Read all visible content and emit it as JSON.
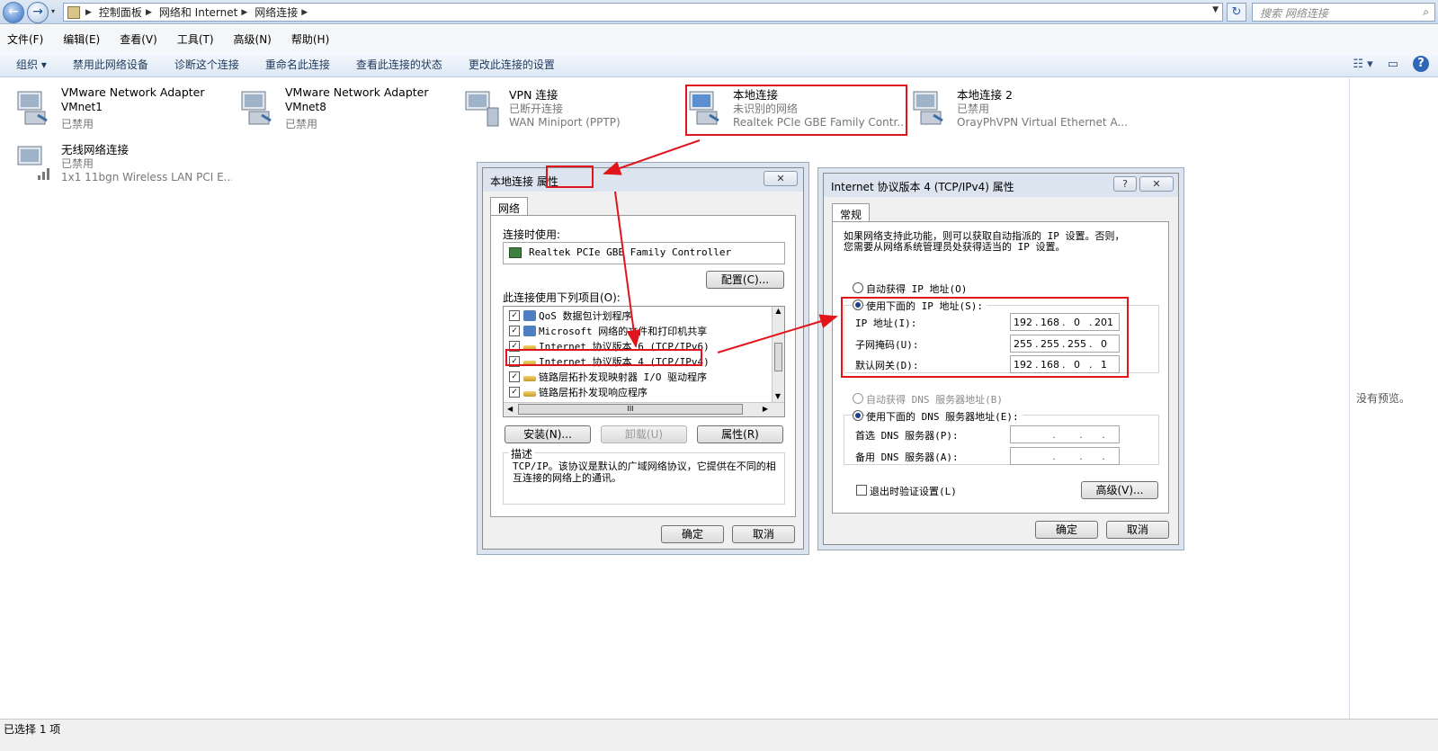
{
  "address": {
    "breadcrumb": [
      "控制面板",
      "网络和 Internet",
      "网络连接"
    ],
    "search_placeholder": "搜索 网络连接"
  },
  "menu": [
    "文件(F)",
    "编辑(E)",
    "查看(V)",
    "工具(T)",
    "高级(N)",
    "帮助(H)"
  ],
  "toolbar": {
    "organize": "组织 ▾",
    "items": [
      "禁用此网络设备",
      "诊断这个连接",
      "重命名此连接",
      "查看此连接的状态",
      "更改此连接的设置"
    ]
  },
  "adapters": [
    {
      "name": "VMware Network Adapter VMnet1",
      "line1": "VMware Network Adapter",
      "line2": "VMnet1",
      "line3": "已禁用"
    },
    {
      "name": "VMware Network Adapter VMnet8",
      "line1": "VMware Network Adapter",
      "line2": "VMnet8",
      "line3": "已禁用"
    },
    {
      "name": "VPN 连接",
      "line1": "VPN 连接",
      "line2": "已断开连接",
      "line3": "WAN Miniport (PPTP)"
    },
    {
      "name": "本地连接",
      "line1": "本地连接",
      "line2": "未识别的网络",
      "line3": "Realtek PCIe GBE Family Contr..."
    },
    {
      "name": "本地连接 2",
      "line1": "本地连接 2",
      "line2": "已禁用",
      "line3": "OrayPhVPN Virtual Ethernet A..."
    },
    {
      "name": "无线网络连接",
      "line1": "无线网络连接",
      "line2": "已禁用",
      "line3": "1x1 11bgn Wireless LAN PCI E..."
    }
  ],
  "preview_text": "没有预览。",
  "status_text": "已选择 1 项",
  "props_dialog": {
    "title": "本地连接 属性",
    "tab": "网络",
    "connect_using_label": "连接时使用:",
    "adapter": "Realtek PCIe GBE Family Controller",
    "configure_button": "配置(C)...",
    "items_label": "此连接使用下列项目(O):",
    "items": [
      {
        "label": "QoS 数据包计划程序",
        "checked": true
      },
      {
        "label": "Microsoft 网络的文件和打印机共享",
        "checked": true
      },
      {
        "label": "Internet 协议版本 6 (TCP/IPv6)",
        "checked": true
      },
      {
        "label": "Internet 协议版本 4 (TCP/IPv4)",
        "checked": true
      },
      {
        "label": "链路层拓扑发现映射器 I/O 驱动程序",
        "checked": true
      },
      {
        "label": "链路层拓扑发现响应程序",
        "checked": true
      }
    ],
    "hscroll_thumb": "III",
    "install_button": "安装(N)...",
    "uninstall_button": "卸载(U)",
    "properties_button": "属性(R)",
    "description_label": "描述",
    "description": "TCP/IP。该协议是默认的广域网络协议，它提供在不同的相互连接的网络上的通讯。",
    "ok_button": "确定",
    "cancel_button": "取消"
  },
  "ipv4_dialog": {
    "title": "Internet 协议版本 4 (TCP/IPv4) 属性",
    "tab": "常规",
    "intro_line1": "如果网络支持此功能，则可以获取自动指派的 IP 设置。否则，",
    "intro_line2": "您需要从网络系统管理员处获得适当的 IP 设置。",
    "auto_ip": "自动获得 IP 地址(O)",
    "manual_ip": "使用下面的 IP 地址(S):",
    "ip_label": "IP 地址(I):",
    "ip": [
      "192",
      "168",
      "0",
      "201"
    ],
    "mask_label": "子网掩码(U):",
    "mask": [
      "255",
      "255",
      "255",
      "0"
    ],
    "gateway_label": "默认网关(D):",
    "gateway": [
      "192",
      "168",
      "0",
      "1"
    ],
    "auto_dns": "自动获得 DNS 服务器地址(B)",
    "manual_dns": "使用下面的 DNS 服务器地址(E):",
    "pref_dns_label": "首选 DNS 服务器(P):",
    "alt_dns_label": "备用 DNS 服务器(A):",
    "validate": "退出时验证设置(L)",
    "advanced_button": "高级(V)...",
    "ok_button": "确定",
    "cancel_button": "取消"
  },
  "colors": {
    "highlight": "#e0141b",
    "title_bg": "#dbe4ef"
  }
}
